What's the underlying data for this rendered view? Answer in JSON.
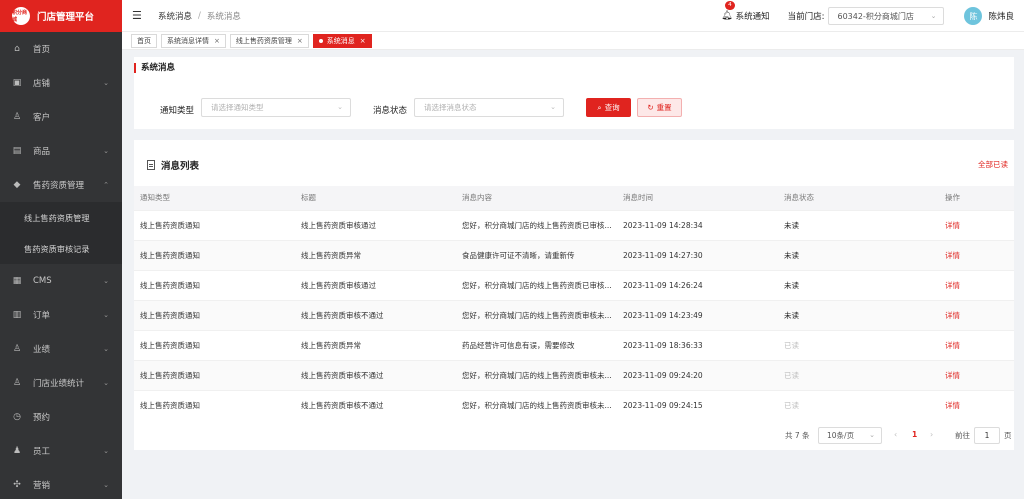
{
  "app": {
    "logo_text": "门店管理平台",
    "logo_mark": "积分商城"
  },
  "sidebar": {
    "items": [
      {
        "label": "首页",
        "icon": "home-icon",
        "glyph": "⌂",
        "chevron": ""
      },
      {
        "label": "店铺",
        "icon": "store-icon",
        "glyph": "▣",
        "chevron": "⌄"
      },
      {
        "label": "客户",
        "icon": "user-icon",
        "glyph": "♙",
        "chevron": ""
      },
      {
        "label": "商品",
        "icon": "goods-icon",
        "glyph": "▤",
        "chevron": "⌄"
      },
      {
        "label": "售药资质管理",
        "icon": "diamond-icon",
        "glyph": "◆",
        "chevron": "⌃"
      },
      {
        "label": "CMS",
        "icon": "cms-icon",
        "glyph": "▦",
        "chevron": "⌄"
      },
      {
        "label": "订单",
        "icon": "order-icon",
        "glyph": "▥",
        "chevron": "⌄"
      },
      {
        "label": "业绩",
        "icon": "performance-icon",
        "glyph": "♙",
        "chevron": "⌄"
      },
      {
        "label": "门店业绩统计",
        "icon": "stats-icon",
        "glyph": "♙",
        "chevron": "⌄"
      },
      {
        "label": "预约",
        "icon": "clock-icon",
        "glyph": "◷",
        "chevron": ""
      },
      {
        "label": "员工",
        "icon": "staff-icon",
        "glyph": "♟",
        "chevron": "⌄"
      },
      {
        "label": "营销",
        "icon": "marketing-icon",
        "glyph": "✣",
        "chevron": "⌄"
      }
    ],
    "submenu": [
      "线上售药资质管理",
      "售药资质审核记录"
    ]
  },
  "topbar": {
    "breadcrumb_1": "系统消息",
    "breadcrumb_sep": "/",
    "breadcrumb_2": "系统消息",
    "notice_label": "系统通知",
    "notice_badge": "4",
    "store_label": "当前门店:",
    "store_value": "60342-积分商城门店",
    "avatar_text": "陈",
    "username": "陈炜良"
  },
  "tabs": [
    {
      "label": "首页",
      "closable": false,
      "active": false
    },
    {
      "label": "系统消息详情",
      "closable": true,
      "active": false
    },
    {
      "label": "线上售药资质管理",
      "closable": true,
      "active": false
    },
    {
      "label": "系统消息",
      "closable": true,
      "active": true
    }
  ],
  "filter": {
    "title": "系统消息",
    "type_label": "通知类型",
    "type_placeholder": "请选择通知类型",
    "status_label": "消息状态",
    "status_placeholder": "请选择消息状态",
    "query_label": "查询",
    "reset_label": "重置"
  },
  "list": {
    "title": "消息列表",
    "read_all": "全部已读",
    "columns": [
      "通知类型",
      "标题",
      "消息内容",
      "消息时间",
      "消息状态",
      "操作"
    ],
    "rows": [
      {
        "type": "线上售药资质通知",
        "title": "线上售药资质审核通过",
        "content": "您好，积分商城门店的线上售药资质已审核...",
        "time": "2023-11-09 14:28:34",
        "status": "未读",
        "op": "详情"
      },
      {
        "type": "线上售药资质通知",
        "title": "线上售药资质异常",
        "content": "食品健康许可证不清晰，请重新传",
        "time": "2023-11-09 14:27:30",
        "status": "未读",
        "op": "详情"
      },
      {
        "type": "线上售药资质通知",
        "title": "线上售药资质审核通过",
        "content": "您好，积分商城门店的线上售药资质已审核...",
        "time": "2023-11-09 14:26:24",
        "status": "未读",
        "op": "详情"
      },
      {
        "type": "线上售药资质通知",
        "title": "线上售药资质审核不通过",
        "content": "您好，积分商城门店的线上售药资质审核未...",
        "time": "2023-11-09 14:23:49",
        "status": "未读",
        "op": "详情"
      },
      {
        "type": "线上售药资质通知",
        "title": "线上售药资质异常",
        "content": "药品经营许可信息有误，需要修改",
        "time": "2023-11-09 18:36:33",
        "status": "已读",
        "op": "详情"
      },
      {
        "type": "线上售药资质通知",
        "title": "线上售药资质审核不通过",
        "content": "您好，积分商城门店的线上售药资质审核未...",
        "time": "2023-11-09 09:24:20",
        "status": "已读",
        "op": "详情"
      },
      {
        "type": "线上售药资质通知",
        "title": "线上售药资质审核不通过",
        "content": "您好，积分商城门店的线上售药资质审核未...",
        "time": "2023-11-09 09:24:15",
        "status": "已读",
        "op": "详情"
      }
    ]
  },
  "pager": {
    "total": "共 7 条",
    "page_size": "10条/页",
    "current": "1",
    "goto_label": "前往",
    "goto_value": "1",
    "page_suffix": "页"
  },
  "colors": {
    "brand": "#e0241f",
    "sidebar_bg": "#333436"
  }
}
